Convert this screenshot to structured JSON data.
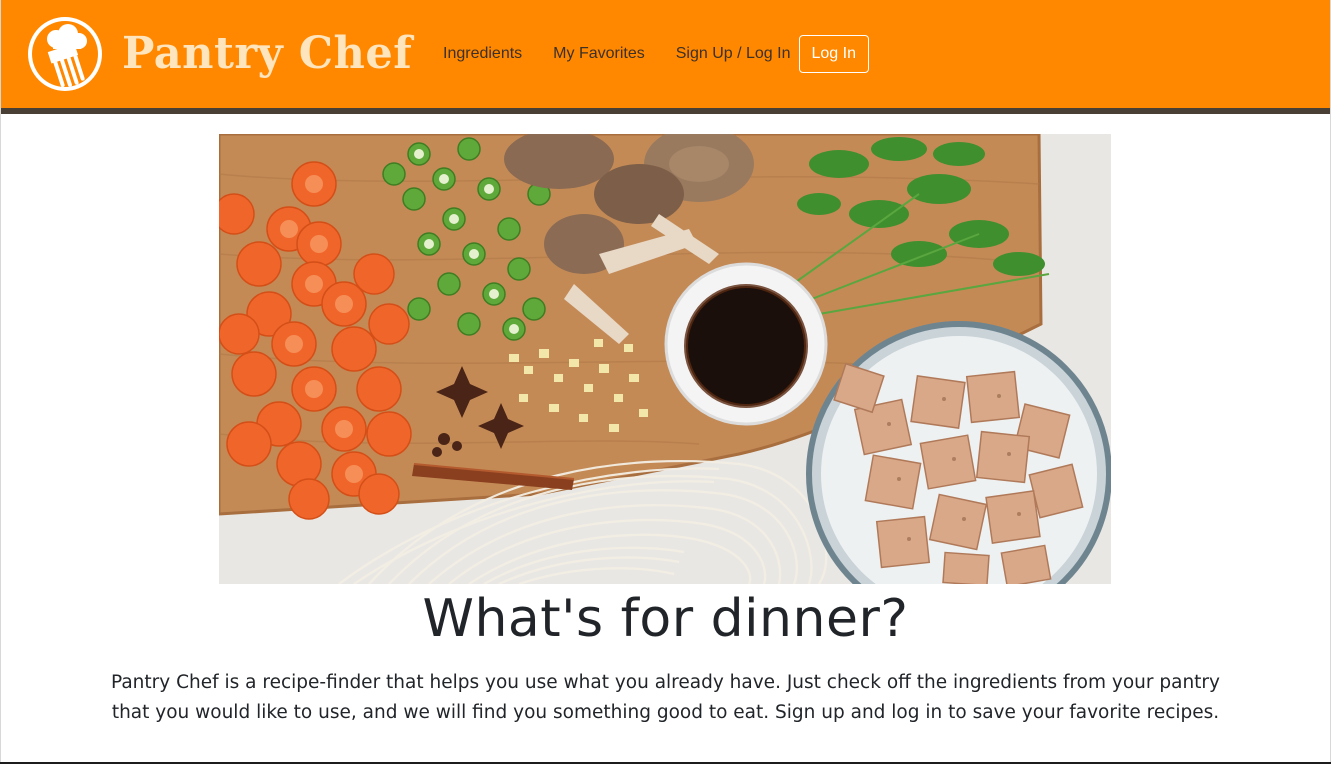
{
  "brand": {
    "name": "Pantry Chef",
    "logo_icon": "chef-hat-fork-icon"
  },
  "nav": {
    "links": [
      {
        "label": "Ingredients"
      },
      {
        "label": "My Favorites"
      },
      {
        "label": "Sign Up / Log In"
      }
    ],
    "login_button": "Log In"
  },
  "hero": {
    "image": "cutting-board-vegetables-soy-sauce-tofu-photo"
  },
  "main": {
    "headline": "What's for dinner?",
    "intro": "Pantry Chef is a recipe-finder that helps you use what you already have. Just check off the ingredients from your pantry that you would like to use, and we will find you something good to eat. Sign up and log in to save your favorite recipes."
  },
  "colors": {
    "navbar": "#ff8800",
    "navbar_rule": "#4a3f35",
    "brand_text": "#ffe5bd",
    "nav_text": "#3d3026",
    "body_text": "#212529"
  }
}
